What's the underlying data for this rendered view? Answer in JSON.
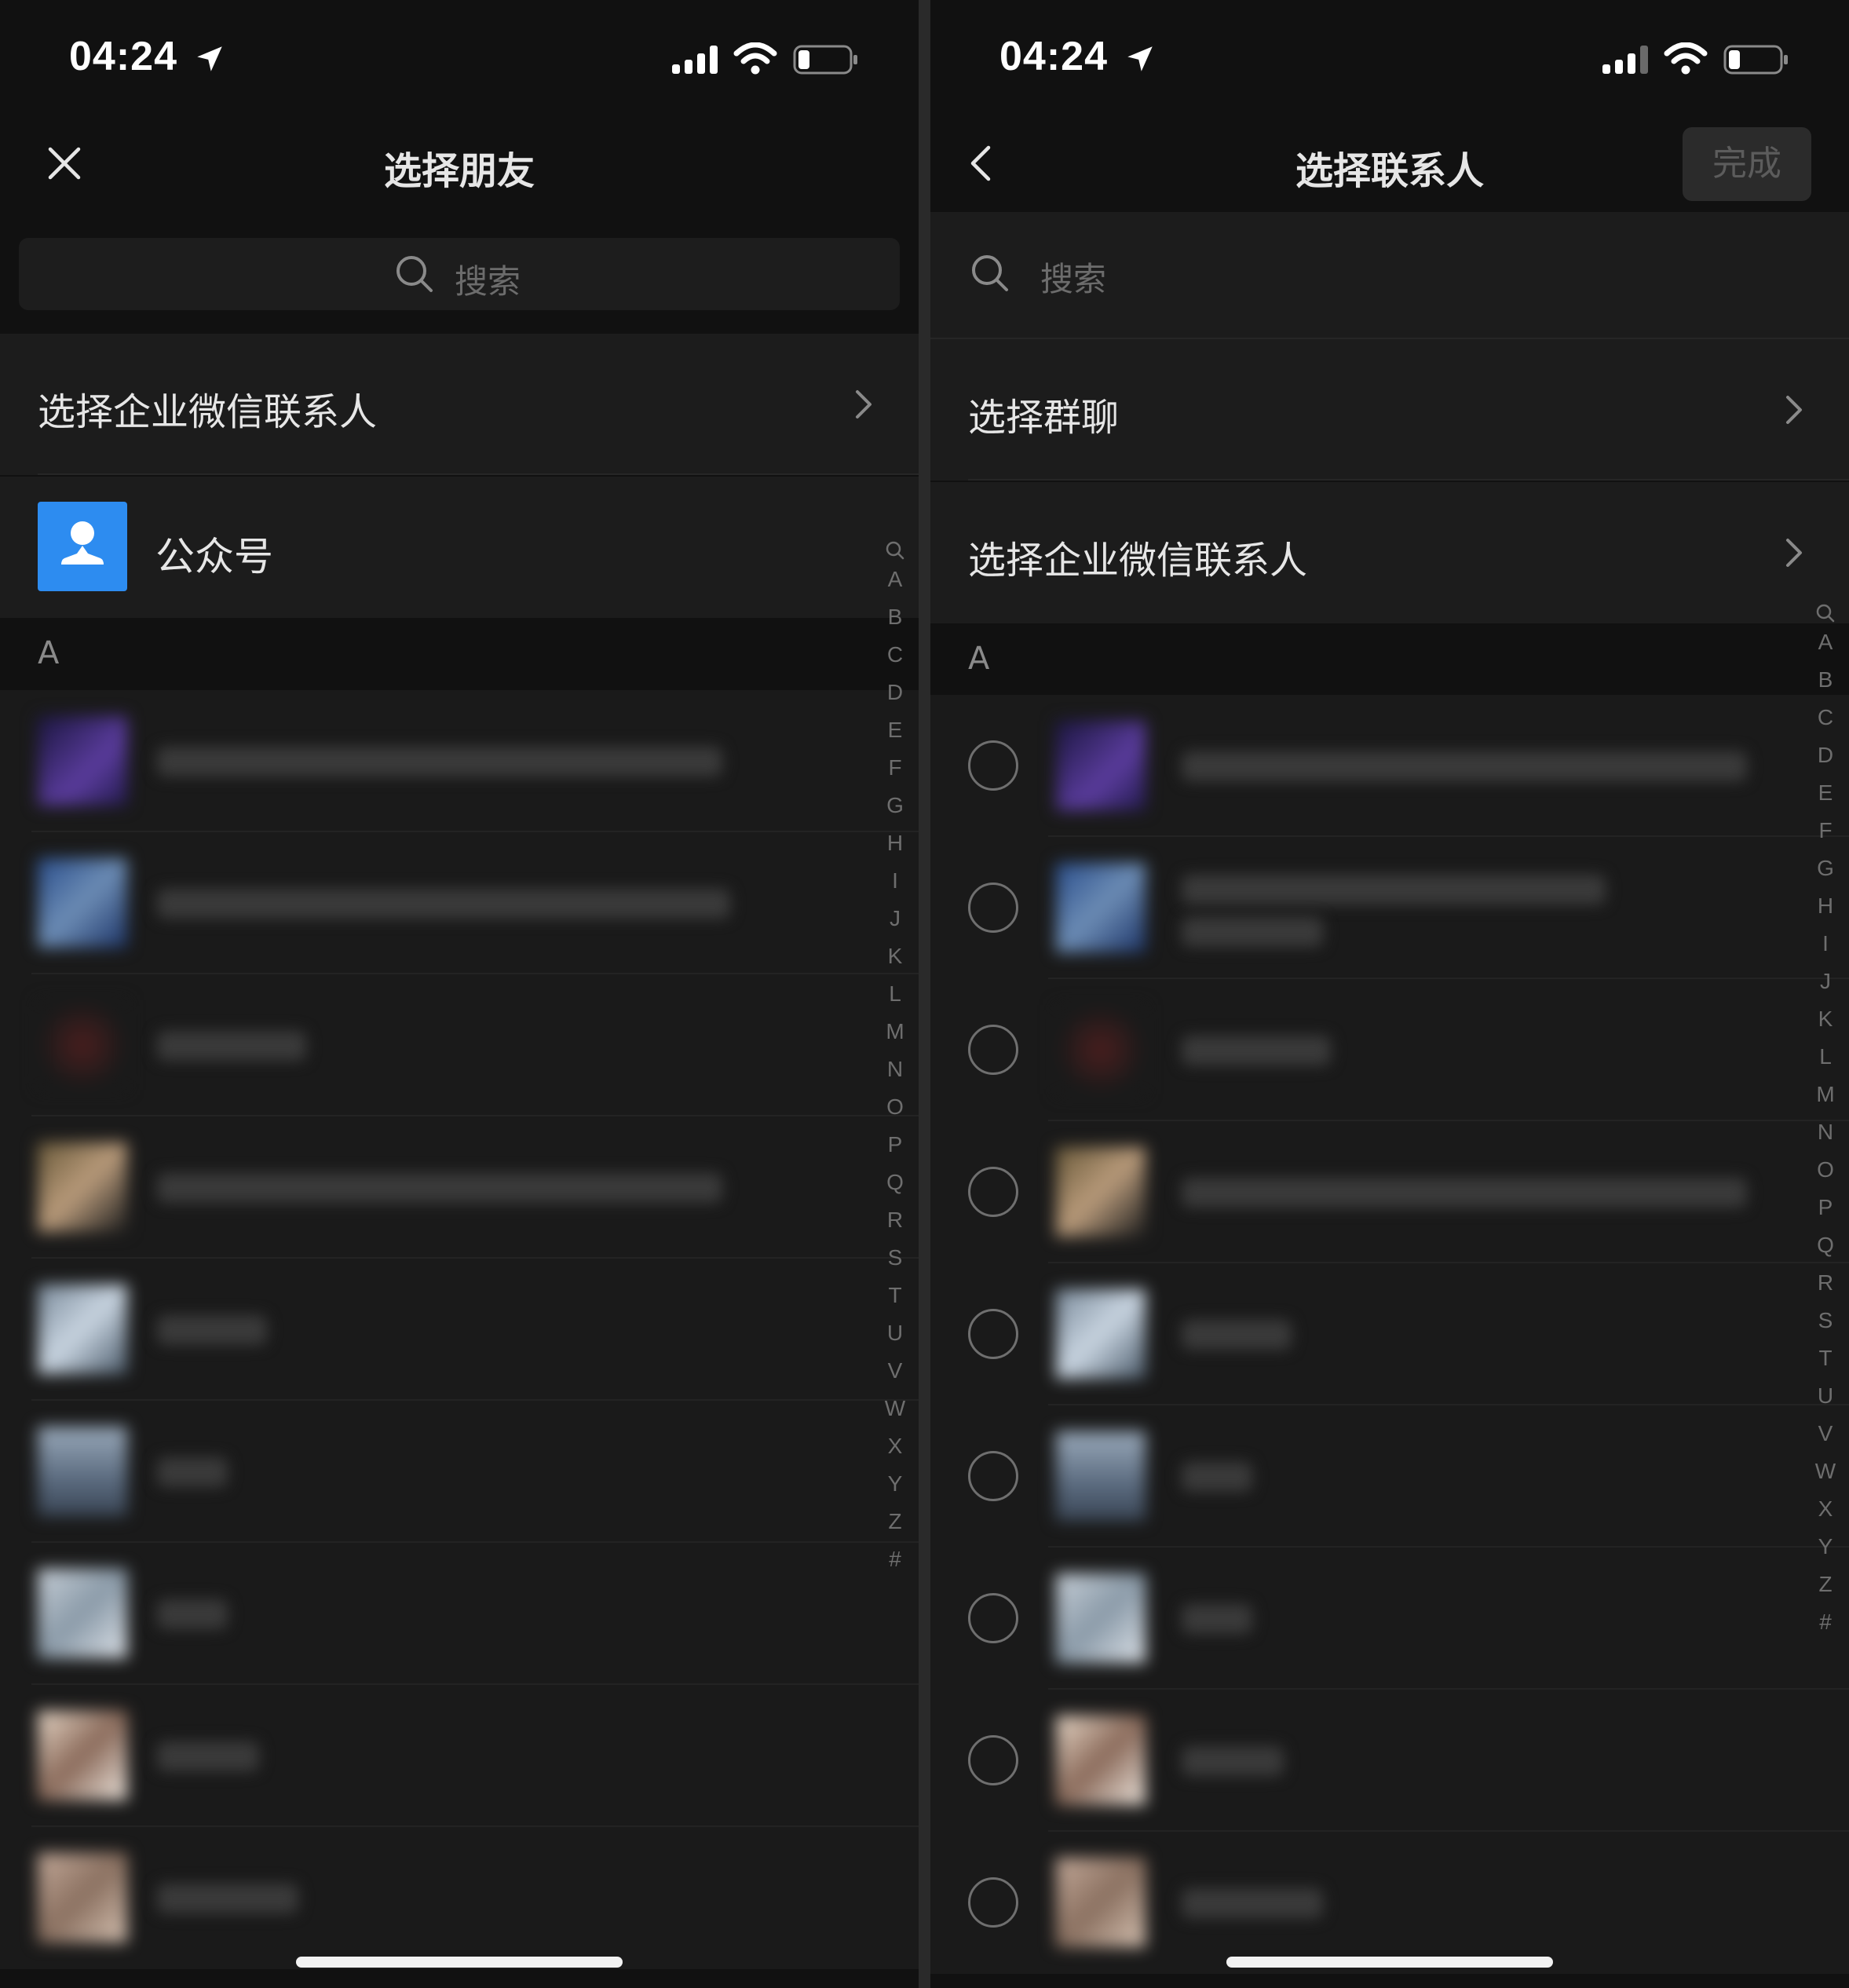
{
  "left": {
    "status": {
      "time": "04:24"
    },
    "nav": {
      "title": "选择朋友"
    },
    "search": {
      "placeholder": "搜索"
    },
    "menu": {
      "enterprise_label": "选择企业微信联系人"
    },
    "official_accounts": {
      "label": "公众号"
    },
    "section": {
      "letter": "A"
    }
  },
  "right": {
    "status": {
      "time": "04:24"
    },
    "nav": {
      "title": "选择联系人",
      "done_label": "完成"
    },
    "search": {
      "placeholder": "搜索"
    },
    "menu": {
      "group_label": "选择群聊",
      "enterprise_label": "选择企业微信联系人"
    },
    "section": {
      "letter": "A"
    }
  },
  "index_letters": [
    "A",
    "B",
    "C",
    "D",
    "E",
    "F",
    "G",
    "H",
    "I",
    "J",
    "K",
    "L",
    "M",
    "N",
    "O",
    "P",
    "Q",
    "R",
    "S",
    "T",
    "U",
    "V",
    "W",
    "X",
    "Y",
    "Z",
    "#"
  ],
  "colors": {
    "accent_blue": "#2d8cf0",
    "background": "#111111",
    "row": "#1c1c1c"
  },
  "icons": [
    "location-arrow-icon",
    "signal-icon",
    "wifi-icon",
    "battery-icon",
    "close-icon",
    "back-icon",
    "search-icon",
    "chevron-right-icon",
    "person-icon"
  ]
}
